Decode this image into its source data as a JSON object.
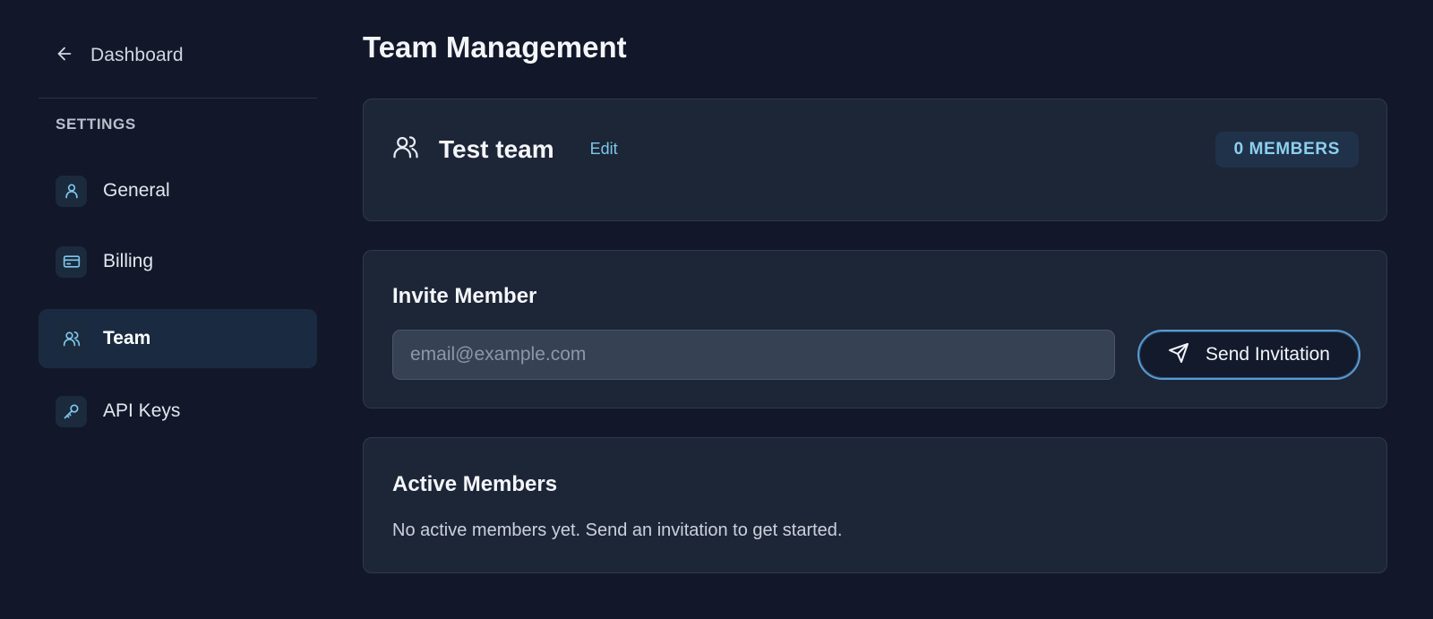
{
  "sidebar": {
    "back_label": "Dashboard",
    "section_heading": "SETTINGS",
    "items": [
      {
        "label": "General",
        "icon": "user-icon",
        "active": false
      },
      {
        "label": "Billing",
        "icon": "credit-card-icon",
        "active": false
      },
      {
        "label": "Team",
        "icon": "users-icon",
        "active": true
      },
      {
        "label": "API Keys",
        "icon": "key-icon",
        "active": false
      }
    ]
  },
  "main": {
    "title": "Team Management",
    "team": {
      "name": "Test team",
      "edit_label": "Edit",
      "member_count_label": "0 MEMBERS",
      "icon": "users-icon"
    },
    "invite": {
      "title": "Invite Member",
      "email_value": "",
      "email_placeholder": "email@example.com",
      "send_label": "Send Invitation",
      "send_icon": "send-icon"
    },
    "members": {
      "title": "Active Members",
      "empty_message": "No active members yet. Send an invitation to get started."
    }
  },
  "colors": {
    "background": "#121829",
    "card": "#1d2637",
    "accent": "#7dc8ea",
    "active_nav": "#1a2b41"
  }
}
